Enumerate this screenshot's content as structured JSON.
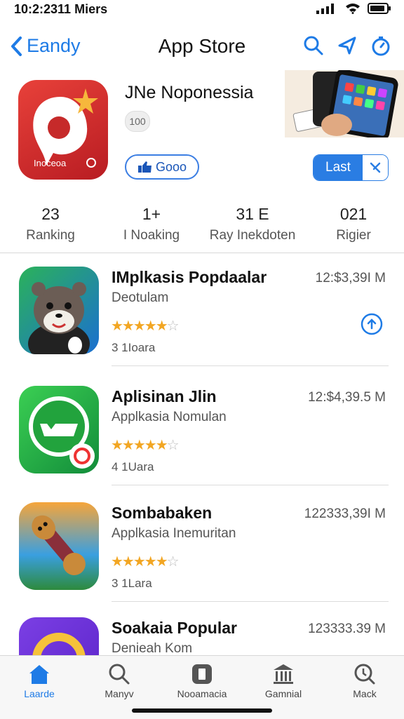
{
  "status": {
    "time": "10:2:2311 Miers"
  },
  "nav": {
    "back_label": "Eandy",
    "title": "App Store"
  },
  "featured": {
    "title": "JNe Noponessia",
    "pill": "100",
    "get_label": "Gooo",
    "icon_text": "Inoceoa",
    "last_label": "Last"
  },
  "stats": [
    {
      "value": "23",
      "label": "Ranking"
    },
    {
      "value": "1+",
      "label": "I Noaking"
    },
    {
      "value": "31 E",
      "label": "Ray Inekdoten"
    },
    {
      "value": "021",
      "label": "Rigier"
    }
  ],
  "apps": [
    {
      "name": "IMplkasis Popdaalar",
      "category": "Deotulam",
      "rating": 4.5,
      "count": "3 1Ioara",
      "size": "12:$3,39I M",
      "download": true
    },
    {
      "name": "Aplisinan Jlin",
      "category": "Applkasia Nomulan",
      "rating": 4.5,
      "count": "4 1Uara",
      "size": "12:$4,39.5 M",
      "download": false
    },
    {
      "name": "Sombabaken",
      "category": "Applkasia Inemuritan",
      "rating": 4.5,
      "count": "3 1Lara",
      "size": "122333,39I M",
      "download": false
    },
    {
      "name": "Soakaia Popular",
      "category": "Denieah Kom",
      "rating": 0,
      "count": "",
      "size": "123333.39 M",
      "download": false
    }
  ],
  "tabs": [
    {
      "label": "Laarde",
      "icon": "home-icon",
      "active": true
    },
    {
      "label": "Manyv",
      "icon": "search-icon",
      "active": false
    },
    {
      "label": "Nooamacia",
      "icon": "apps-icon",
      "active": false
    },
    {
      "label": "Gamnial",
      "icon": "games-icon",
      "active": false
    },
    {
      "label": "Mack",
      "icon": "updates-icon",
      "active": false
    }
  ],
  "colors": {
    "accent": "#1e7be6",
    "star": "#f2a623"
  }
}
